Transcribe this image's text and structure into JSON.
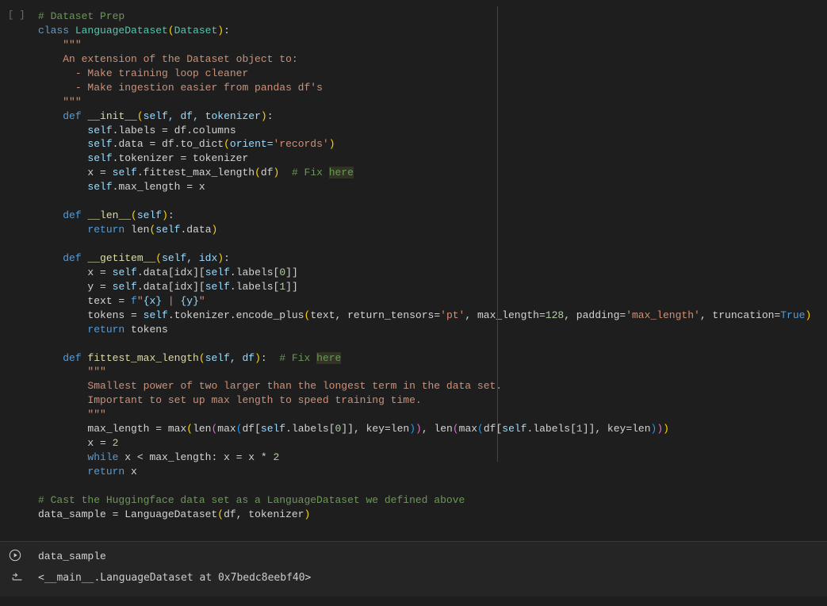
{
  "cell1": {
    "gutter": "[ ]",
    "l0_comment": "# Dataset Prep",
    "l1_class_kw": "class",
    "l1_name": "LanguageDataset",
    "l1_base": "Dataset",
    "doc_open": "\"\"\"",
    "doc_l1": "An extension of the Dataset object to:",
    "doc_l2": "  - Make training loop cleaner",
    "doc_l3": "  - Make ingestion easier from pandas df's",
    "doc_close": "\"\"\"",
    "def": "def",
    "init_name": "__init__",
    "init_params": "self, df, tokenizer",
    "init_b1_a": "self",
    "init_b1_b": ".labels = df.columns",
    "init_b2_a": "self",
    "init_b2_b": ".data = df.to_dict",
    "init_b2_c": "orient=",
    "init_b2_d": "'records'",
    "init_b3_a": "self",
    "init_b3_b": ".tokenizer = tokenizer",
    "init_b4_a": "x = ",
    "init_b4_b": "self",
    "init_b4_c": ".fittest_max_length",
    "init_b4_d": "df",
    "init_b4_cmt": "# Fix ",
    "init_b4_hl": "here",
    "init_b5_a": "self",
    "init_b5_b": ".max_length = x",
    "len_name": "__len__",
    "len_params": "self",
    "len_b1_a": "return",
    "len_b1_b": " len",
    "len_b1_c": "self",
    "len_b1_d": ".data",
    "gi_name": "__getitem__",
    "gi_params": "self, idx",
    "gi_b1": "x = ",
    "gi_b1_self": "self",
    "gi_b1_rest1": ".data[idx][",
    "gi_b1_rest2": ".labels[",
    "gi_b1_zero": "0",
    "gi_b1_end": "]]",
    "gi_b2": "y = ",
    "gi_b2_self": "self",
    "gi_b2_rest1": ".data[idx][",
    "gi_b2_rest2": ".labels[",
    "gi_b2_one": "1",
    "gi_b2_end": "]]",
    "gi_b3_a": "text = ",
    "gi_b3_f": "f",
    "gi_b3_s1": "\"",
    "gi_b3_s2": "{x}",
    "gi_b3_s3": " | ",
    "gi_b3_s4": "{y}",
    "gi_b3_s5": "\"",
    "gi_b4_a": "tokens = ",
    "gi_b4_self": "self",
    "gi_b4_b": ".tokenizer.encode_plus",
    "gi_b4_c": "text, return_tensors=",
    "gi_b4_d": "'pt'",
    "gi_b4_e": ", max_length=",
    "gi_b4_num": "128",
    "gi_b4_f2": ", padding=",
    "gi_b4_g": "'max_length'",
    "gi_b4_h": ", truncation=",
    "gi_b4_true": "True",
    "gi_b5": "return",
    "gi_b5_b": " tokens",
    "fml_name": "fittest_max_length",
    "fml_params": "self, df",
    "fml_cmt": "# Fix ",
    "fml_hl": "here",
    "fml_doc_open": "\"\"\"",
    "fml_doc_l1": "Smallest power of two larger than the longest term in the data set.",
    "fml_doc_l2": "Important to set up max length to speed training time.",
    "fml_doc_close": "\"\"\"",
    "fml_b1_a": "max_length = max",
    "fml_b1_b": "len",
    "fml_b1_c": "max",
    "fml_b1_d": "df[",
    "fml_b1_self": "self",
    "fml_b1_e": ".labels[",
    "fml_b1_zero": "0",
    "fml_b1_f": "]], key=len",
    "fml_b1_g": ", len",
    "fml_b1_h": "max",
    "fml_b1_i": "df[",
    "fml_b1_j": ".labels[",
    "fml_b1_one": "1",
    "fml_b1_k": "]], key=len",
    "fml_b2_a": "x = ",
    "fml_b2_two": "2",
    "fml_b3_a": "while",
    "fml_b3_b": " x < max_length: x = x * ",
    "fml_b3_two": "2",
    "fml_b4_a": "return",
    "fml_b4_b": " x",
    "cast_cmt": "# Cast the Huggingface data set as a LanguageDataset we defined above",
    "ds_a": "data_sample = LanguageDataset",
    "ds_b": "df, tokenizer"
  },
  "cell2": {
    "code": "data_sample",
    "output": "<__main__.LanguageDataset at 0x7bedc8eebf40>"
  }
}
